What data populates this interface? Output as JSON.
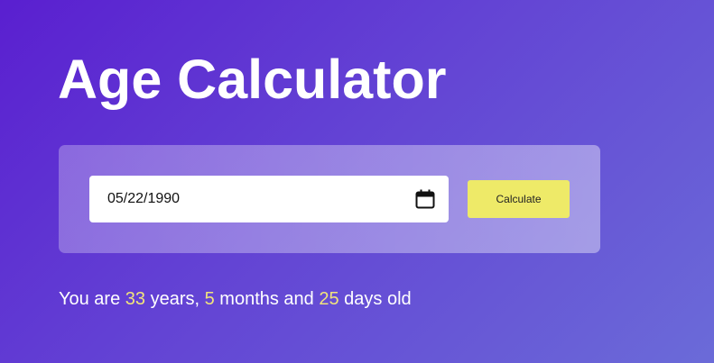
{
  "app": {
    "title": "Age Calculator"
  },
  "form": {
    "date_value": "05/22/1990",
    "calculate_label": "Calculate"
  },
  "result": {
    "prefix": "You are ",
    "years": "33",
    "years_label": " years, ",
    "months": "5",
    "months_label": " months and ",
    "days": "25",
    "days_label": " days old"
  },
  "icons": {
    "calendar": "calendar-icon"
  },
  "colors": {
    "background_start": "#5a1fd0",
    "background_end": "#6b6bd8",
    "button": "#eeea68",
    "highlight_number": "#f1e47c"
  }
}
